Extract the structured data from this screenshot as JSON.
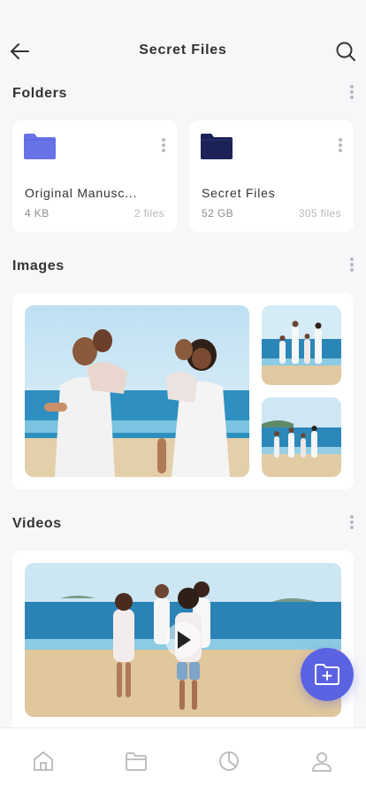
{
  "header": {
    "title": "Secret Files",
    "back_icon": "arrow-left-icon",
    "search_icon": "search-icon"
  },
  "sections": {
    "folders": "Folders",
    "images": "Images",
    "videos": "Videos"
  },
  "folders": [
    {
      "name": "Original Manusc...",
      "size": "4 KB",
      "count": "2 files",
      "color": "#6873e8"
    },
    {
      "name": "Secret Files",
      "size": "52 GB",
      "count": "305 files",
      "color": "#1b2257"
    }
  ],
  "fab": {
    "icon": "add-folder-icon",
    "color": "#5b63e2"
  },
  "tabbar": {
    "items": [
      "home-icon",
      "folder-icon",
      "pie-chart-icon",
      "user-icon"
    ]
  }
}
